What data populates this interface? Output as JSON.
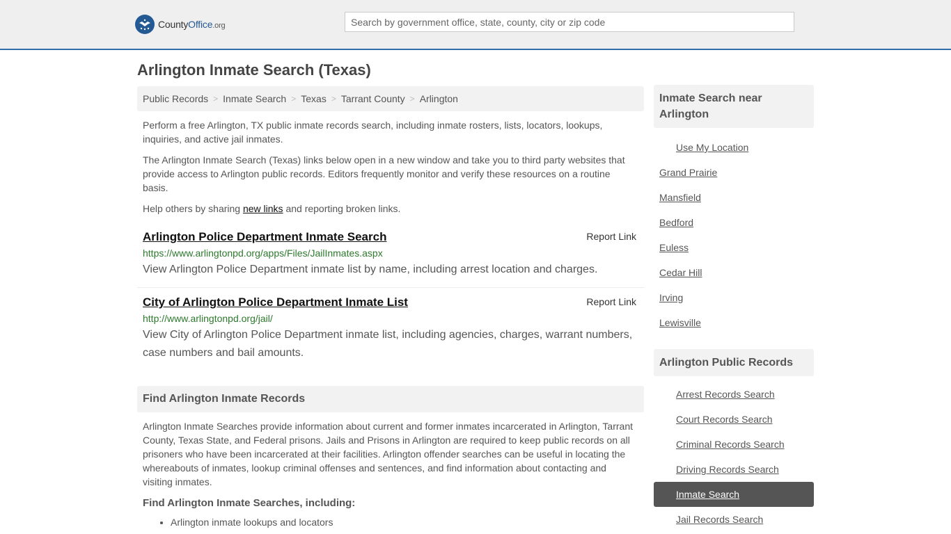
{
  "header": {
    "logo_county": "County",
    "logo_office": "Office",
    "logo_tld": ".org",
    "search_placeholder": "Search by government office, state, county, city or zip code"
  },
  "page": {
    "title": "Arlington Inmate Search (Texas)"
  },
  "breadcrumb": [
    "Public Records",
    "Inmate Search",
    "Texas",
    "Tarrant County",
    "Arlington"
  ],
  "intro": {
    "p1": "Perform a free Arlington, TX public inmate records search, including inmate rosters, lists, locators, lookups, inquiries, and active jail inmates.",
    "p2": "The Arlington Inmate Search (Texas) links below open in a new window and take you to third party websites that provide access to Arlington public records. Editors frequently monitor and verify these resources on a routine basis.",
    "p3_before": "Help others by sharing ",
    "p3_link": "new links",
    "p3_after": " and reporting broken links."
  },
  "results": [
    {
      "title": "Arlington Police Department Inmate Search",
      "report": "Report Link",
      "url": "https://www.arlingtonpd.org/apps/Files/JailInmates.aspx",
      "desc": "View Arlington Police Department inmate list by name, including arrest location and charges."
    },
    {
      "title": "City of Arlington Police Department Inmate List",
      "report": "Report Link",
      "url": "http://www.arlingtonpd.org/jail/",
      "desc": "View City of Arlington Police Department inmate list, including agencies, charges, warrant numbers, case numbers and bail amounts."
    }
  ],
  "find": {
    "heading": "Find Arlington Inmate Records",
    "body": "Arlington Inmate Searches provide information about current and former inmates incarcerated in Arlington, Tarrant County, Texas State, and Federal prisons. Jails and Prisons in Arlington are required to keep public records on all prisoners who have been incarcerated at their facilities. Arlington offender searches can be useful in locating the whereabouts of inmates, lookup criminal offenses and sentences, and find information about contacting and visiting inmates.",
    "subheading": "Find Arlington Inmate Searches, including:",
    "bullets": [
      "Arlington inmate lookups and locators"
    ]
  },
  "sidebar": {
    "near_heading": "Inmate Search near Arlington",
    "use_location": "Use My Location",
    "near_cities": [
      "Grand Prairie",
      "Mansfield",
      "Bedford",
      "Euless",
      "Cedar Hill",
      "Irving",
      "Lewisville"
    ],
    "records_heading": "Arlington Public Records",
    "records_links": [
      "Arrest Records Search",
      "Court Records Search",
      "Criminal Records Search",
      "Driving Records Search",
      "Inmate Search",
      "Jail Records Search"
    ],
    "active_link": "Inmate Search"
  },
  "colors": {
    "header_bg": "#efefef",
    "brand_blue": "#245a94",
    "url_green": "#2c7a2c",
    "active_bg": "#555555"
  }
}
